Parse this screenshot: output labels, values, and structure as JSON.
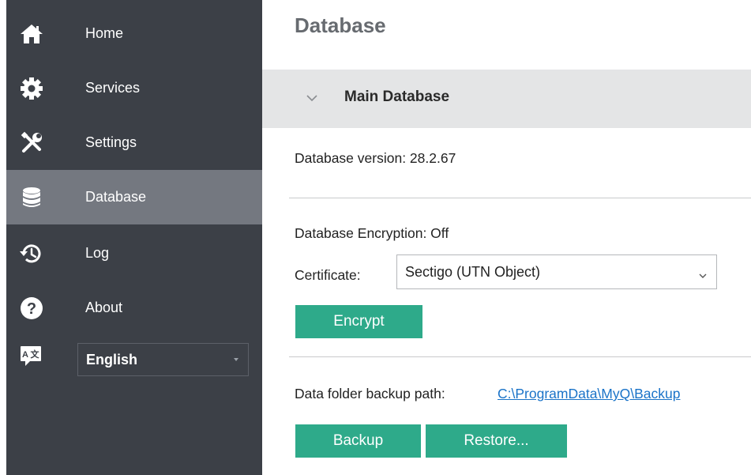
{
  "sidebar": {
    "items": [
      {
        "label": "Home",
        "icon": "home-icon"
      },
      {
        "label": "Services",
        "icon": "gear-icon"
      },
      {
        "label": "Settings",
        "icon": "tools-icon"
      },
      {
        "label": "Database",
        "icon": "database-icon",
        "active": true
      },
      {
        "label": "Log",
        "icon": "history-icon"
      },
      {
        "label": "About",
        "icon": "help-icon"
      }
    ],
    "language": {
      "selected": "English",
      "icon": "translate-icon"
    }
  },
  "main": {
    "title": "Database",
    "section": {
      "title": "Main Database",
      "expanded": true
    },
    "version_text": "Database version: 28.2.67",
    "encryption_text": "Database Encryption: Off",
    "certificate_label": "Certificate:",
    "certificate_value": "Sectigo (UTN Object)",
    "encrypt_label": "Encrypt",
    "backup_path_label": "Data folder backup path:",
    "backup_path_value": "C:\\ProgramData\\MyQ\\Backup",
    "backup_label": "Backup",
    "restore_label": "Restore..."
  },
  "colors": {
    "sidebar_bg": "#3c4047",
    "sidebar_active": "#747880",
    "accent": "#2eaa8a",
    "link": "#1a73c8",
    "section_bg": "#e4e5e6"
  }
}
